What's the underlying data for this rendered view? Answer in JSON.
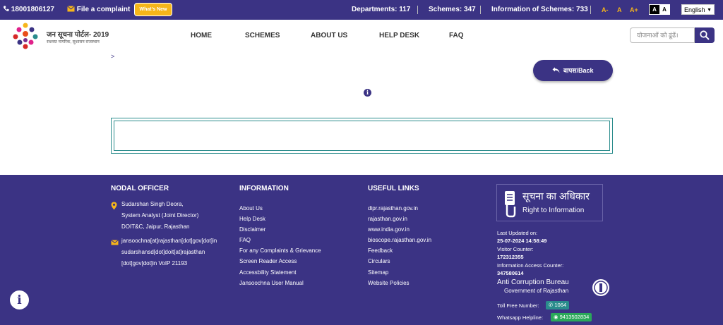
{
  "topbar": {
    "phone": "18001806127",
    "complaint": "File a complaint",
    "whats_new": "What's New",
    "departments": "Departments: 117",
    "schemes": "Schemes: 347",
    "info_schemes": "Information of Schemes: 733",
    "font_small": "A-",
    "font_normal": "A",
    "font_large": "A+",
    "contrast_dark": "A",
    "contrast_light": "A",
    "language": "English"
  },
  "header": {
    "logo_title": "जन सूचना पोर्टल- 2019",
    "logo_subtitle": "सशक्त नागरिक, सुशासन राजस्थान",
    "nav": [
      "HOME",
      "SCHEMES",
      "ABOUT US",
      "HELP DESK",
      "FAQ"
    ],
    "search_placeholder": "योजनाओं को ढूंढें।"
  },
  "content": {
    "breadcrumb": ">",
    "back_label": "वापस/Back",
    "info_glyph": "i"
  },
  "footer": {
    "nodal": {
      "title": "NODAL OFFICER",
      "name": "Sudarshan Singh Deora,",
      "designation": "System Analyst (Joint Director)",
      "office": "DOIT&C, Jaipur, Rajasthan",
      "email_1": "jansoochna[at]rajasthan[dot]gov[dot]in",
      "email_2": "sudarshansd[dot]doit[at]rajasthan",
      "email_3": "[dot]gov[dot]in VoIP 21193"
    },
    "information": {
      "title": "INFORMATION",
      "links": [
        "About Us",
        "Help Desk",
        "Disclaimer",
        "FAQ",
        "For any Complaints & Grievance",
        "Screen Reader Access",
        "Accessbility Statement",
        "Jansoochna User Manual"
      ]
    },
    "useful": {
      "title": "USEFUL LINKS",
      "links": [
        "dipr.rajasthan.gov.in",
        "rajasthan.gov.in",
        "www.india.gov.in",
        "bioscope.rajasthan.gov.in",
        "Feedback",
        "Circulars",
        "Sitemap",
        "Website Policies"
      ]
    },
    "rti": {
      "hindi": "सूचना का अधिकार",
      "english": "Right to Information"
    },
    "stats": {
      "updated_label": "Last Updated on:",
      "updated_value": "25-07-2024 14:58:49",
      "visitor_label": "Visitor Counter:",
      "visitor_value": "172312355",
      "access_label": "Information Access Counter:",
      "access_value": "347580614"
    },
    "acb": {
      "title": "Anti Corruption Bureau",
      "subtitle": "Government of Rajasthan",
      "toll_label": "Toll Free Number:",
      "toll_value": "1064",
      "whatsapp_label": "Whatsapp Helpline:",
      "whatsapp_value": "9413502834"
    }
  },
  "floating_info": "i",
  "colors": {
    "primary": "#3b3384",
    "accent": "#f6b51a",
    "teal": "#2a8c8c",
    "green": "#2aa85a"
  }
}
